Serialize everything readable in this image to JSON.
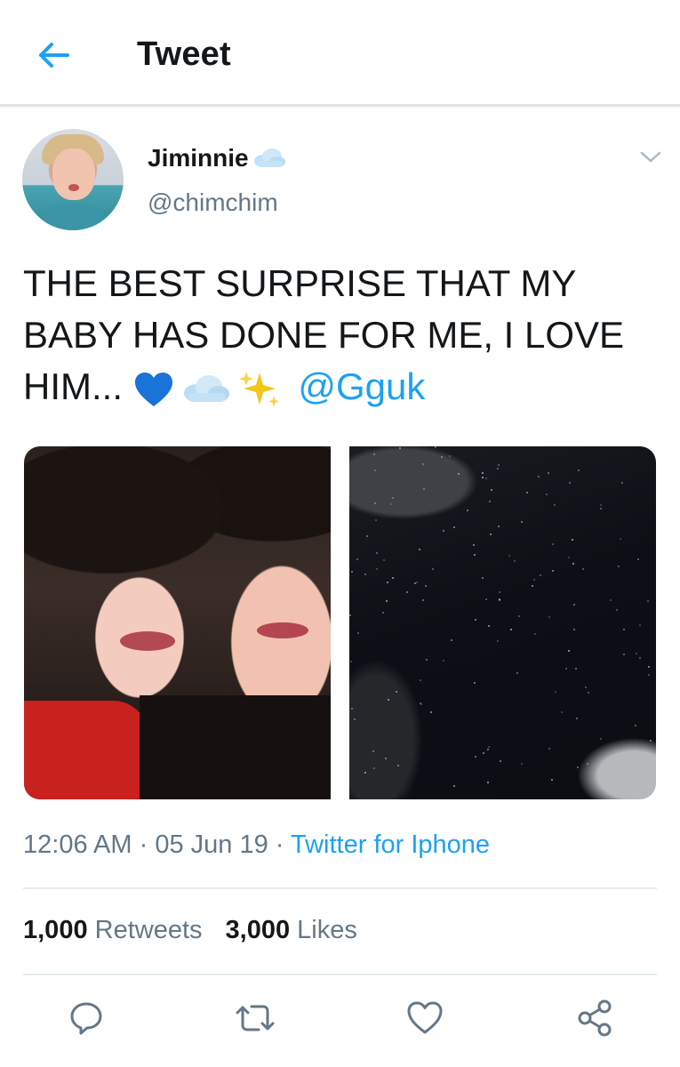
{
  "header": {
    "title": "Tweet"
  },
  "author": {
    "display_name": "Jiminnie",
    "handle": "@chimchim"
  },
  "tweet": {
    "text": "THE BEST SURPRISE THAT MY BABY HAS DONE FOR ME, I LOVE HIM...",
    "emojis": [
      "blue-heart",
      "cloud",
      "sparkles"
    ],
    "mention": "@Gguk"
  },
  "meta": {
    "time": "12:06 AM",
    "date": "05 Jun 19",
    "separator": "·",
    "source": "Twitter for Iphone"
  },
  "stats": {
    "retweets_count": "1,000",
    "retweets_label": "Retweets",
    "likes_count": "3,000",
    "likes_label": "Likes"
  },
  "colors": {
    "accent": "#1da1f2",
    "secondary_text": "#657786",
    "primary_text": "#14171a"
  },
  "actions": [
    "reply-icon",
    "retweet-icon",
    "like-icon",
    "share-icon"
  ]
}
